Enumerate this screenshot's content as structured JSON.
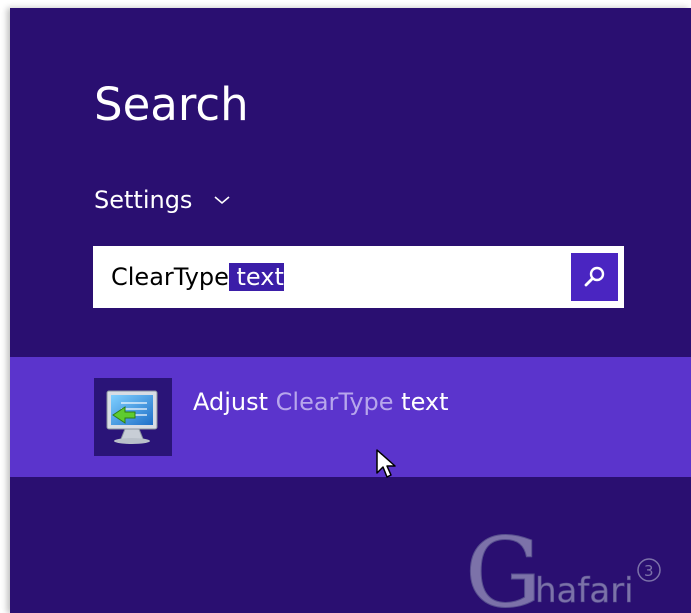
{
  "search": {
    "title": "Search",
    "scope_label": "Settings",
    "query_plain": "ClearType",
    "query_selected": " text",
    "button_icon": "search-icon"
  },
  "results": [
    {
      "label_part1": "Adjust ",
      "label_part2": "ClearType",
      "label_part3": " text",
      "icon": "monitor-cleartype-icon"
    }
  ],
  "watermark": {
    "letter": "G",
    "text": "hafari",
    "mark": "3"
  },
  "colors": {
    "background": "#2a0f71",
    "result_highlight": "#5b34cc",
    "search_button": "#4a25c1",
    "selection": "#3b1ea8"
  }
}
